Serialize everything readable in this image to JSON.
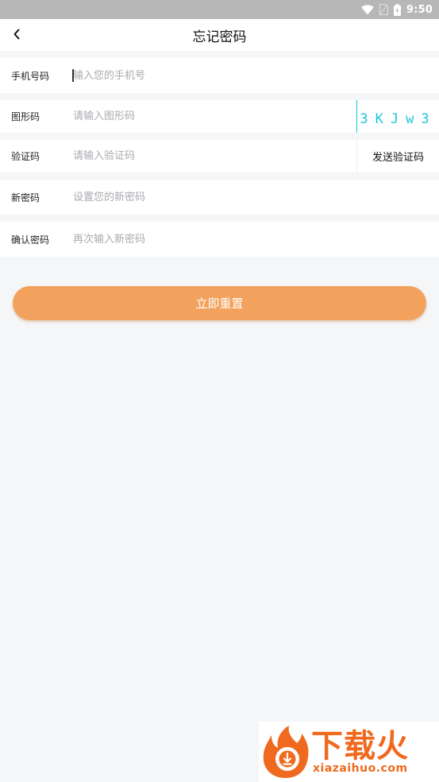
{
  "status_bar": {
    "time": "9:50",
    "icons": [
      "wifi-icon",
      "sim-icon",
      "battery-icon"
    ]
  },
  "header": {
    "title": "忘记密码",
    "back_icon": "chevron-left-icon"
  },
  "form": {
    "phone": {
      "label": "手机号码",
      "placeholder": "输入您的手机号",
      "value": ""
    },
    "captcha": {
      "label": "图形码",
      "placeholder": "请输入图形码",
      "value": "",
      "captcha_text": "3KJw3"
    },
    "sms_code": {
      "label": "验证码",
      "placeholder": "请输入验证码",
      "value": "",
      "send_label": "发送验证码"
    },
    "new_password": {
      "label": "新密码",
      "placeholder": "设置您的新密码",
      "value": ""
    },
    "confirm_password": {
      "label": "确认密码",
      "placeholder": "再次输入新密码",
      "value": ""
    }
  },
  "submit": {
    "label": "立即重置"
  },
  "watermark": {
    "title": "下载火",
    "subtitle": "xiazaihuo.com"
  },
  "colors": {
    "accent": "#f2a25c",
    "captcha": "#19c8d9",
    "background": "#f5f6f8",
    "status_bar": "#b7b7b7",
    "watermark": "#ef6a1e"
  }
}
